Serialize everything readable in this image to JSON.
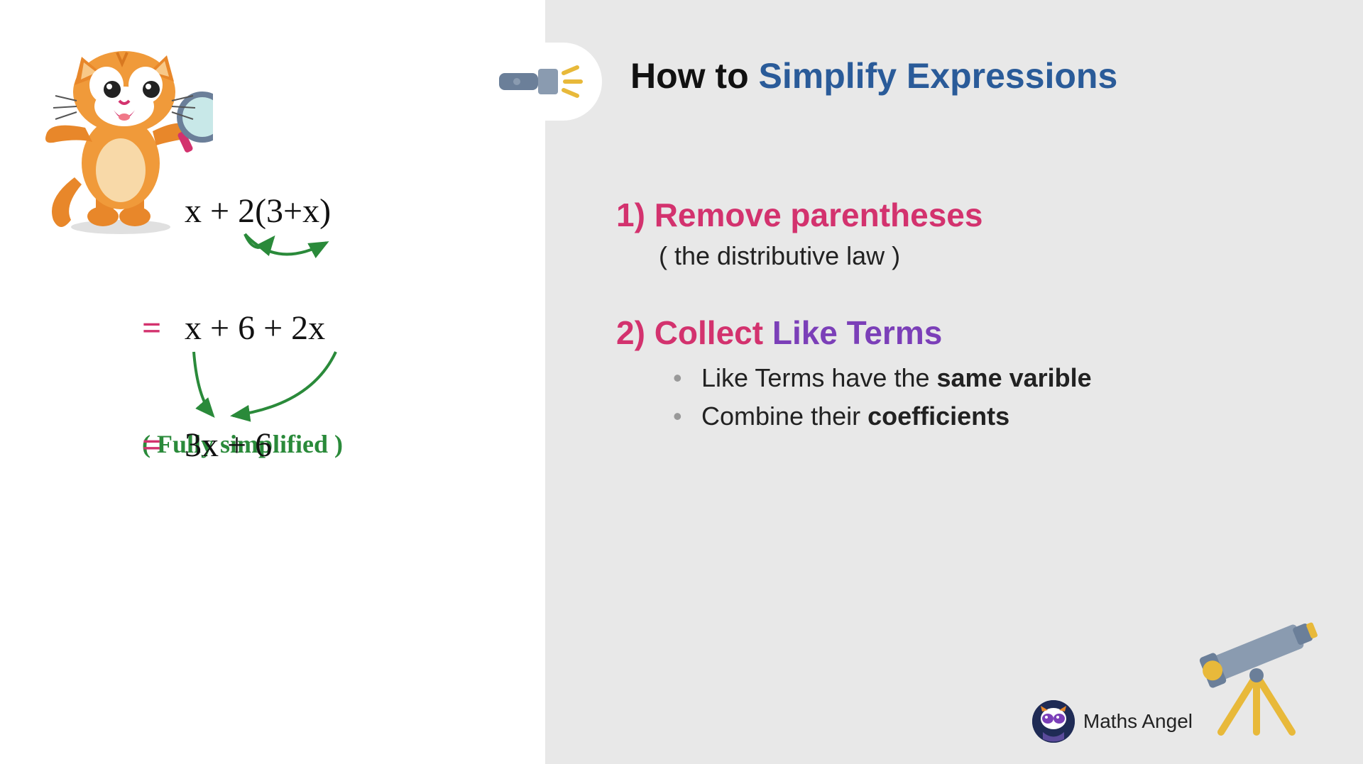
{
  "title": {
    "prefix": "How to",
    "highlight": "Simplify Expressions"
  },
  "steps": [
    {
      "number": "1)",
      "heading": "Remove parentheses",
      "subtext": "( the distributive law )"
    },
    {
      "number": "2)",
      "heading_pink": "Collect",
      "heading_purple": "Like Terms",
      "bullets": [
        {
          "pre": "Like Terms have the ",
          "bold": "same varible"
        },
        {
          "pre": "Combine their ",
          "bold": "coefficients"
        }
      ]
    }
  ],
  "math": {
    "line1": "x + 2(3+x)",
    "line2": "x + 6 + 2x",
    "line3": "3x + 6",
    "simplified_label": "( Fully simplified )"
  },
  "brand": {
    "name": "Maths Angel"
  },
  "colors": {
    "pink": "#d3326e",
    "purple": "#7b3fb8",
    "blue": "#2a5b99",
    "green": "#2a8a3a",
    "slate": "#6b7f99",
    "yellow": "#e8b93a"
  }
}
